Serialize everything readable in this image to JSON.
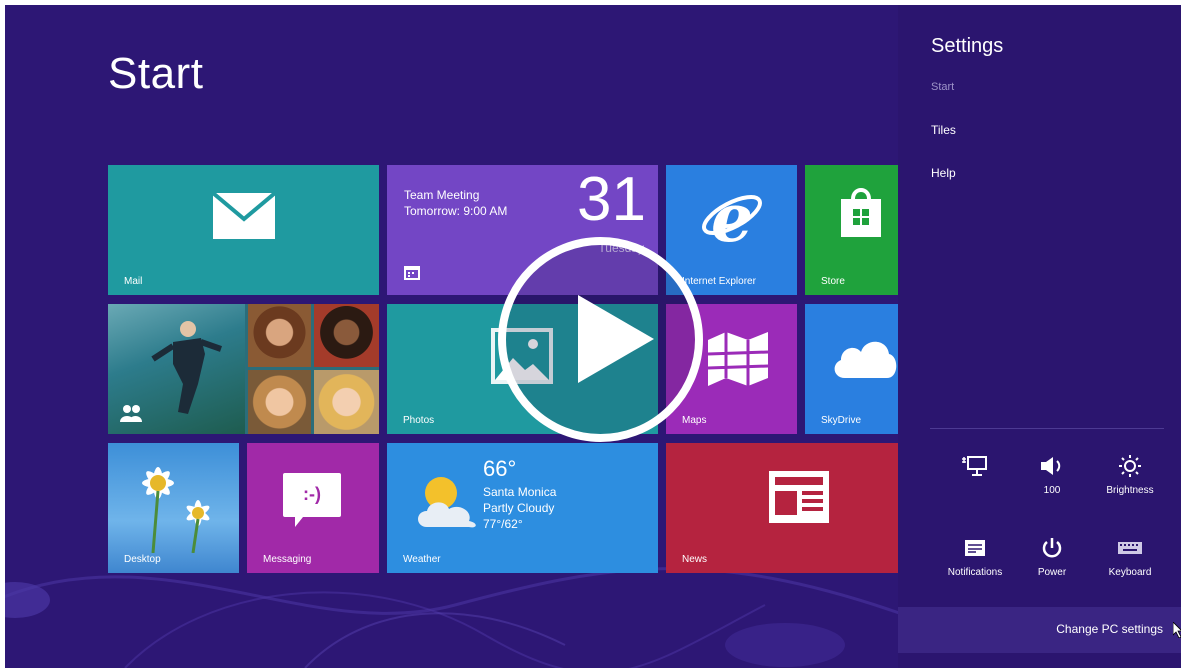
{
  "start": {
    "title": "Start"
  },
  "tiles": {
    "mail": {
      "label": "Mail"
    },
    "calendar": {
      "event_title": "Team Meeting",
      "event_time": "Tomorrow: 9:00 AM",
      "day": "31",
      "weekday": "Tuesday"
    },
    "ie": {
      "label": "Internet Explorer"
    },
    "store": {
      "label": "Store"
    },
    "photos": {
      "label": "Photos"
    },
    "maps": {
      "label": "Maps"
    },
    "skydrive": {
      "label": "SkyDrive"
    },
    "desktop": {
      "label": "Desktop"
    },
    "messaging": {
      "label": "Messaging",
      "emoticon": ":-)"
    },
    "weather": {
      "label": "Weather",
      "temp": "66°",
      "city": "Santa Monica",
      "condition": "Partly Cloudy",
      "range": "77°/62°"
    },
    "news": {
      "label": "News"
    }
  },
  "charm": {
    "title": "Settings",
    "subtitle": "Start",
    "links": [
      "Tiles",
      "Help"
    ],
    "quick_settings": [
      {
        "icon": "network-icon",
        "label": ""
      },
      {
        "icon": "volume-icon",
        "label": "100"
      },
      {
        "icon": "brightness-icon",
        "label": "Brightness"
      },
      {
        "icon": "notifications-icon",
        "label": "Notifications"
      },
      {
        "icon": "power-icon",
        "label": "Power"
      },
      {
        "icon": "keyboard-icon",
        "label": "Keyboard"
      }
    ],
    "change_pc_settings": "Change PC settings"
  },
  "colors": {
    "background": "#2d1775",
    "mail": "#1f9aa0",
    "calendar": "#7346c5",
    "ie": "#2a7fe0",
    "store": "#1fa23c",
    "photos": "#1f9aa0",
    "maps": "#9b2bb8",
    "skydrive": "#2a7fe0",
    "messaging": "#a129a8",
    "weather": "#2d8ee0",
    "news": "#b5233f"
  }
}
